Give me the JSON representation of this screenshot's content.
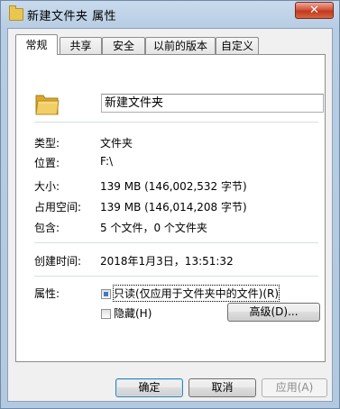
{
  "window": {
    "title": "新建文件夹 属性",
    "close_label": "✕"
  },
  "tabs": [
    {
      "label": "常规",
      "active": true
    },
    {
      "label": "共享",
      "active": false
    },
    {
      "label": "安全",
      "active": false
    },
    {
      "label": "以前的版本",
      "active": false
    },
    {
      "label": "自定义",
      "active": false
    }
  ],
  "general": {
    "name_value": "新建文件夹",
    "type_label": "类型:",
    "type_value": "文件夹",
    "location_label": "位置:",
    "location_value": "F:\\",
    "size_label": "大小:",
    "size_value": "139 MB (146,002,532 字节)",
    "size_on_disk_label": "占用空间:",
    "size_on_disk_value": "139 MB (146,014,208 字节)",
    "contains_label": "包含:",
    "contains_value": "5 个文件，0 个文件夹",
    "created_label": "创建时间:",
    "created_value": "2018年1月3日，13:51:32",
    "attributes_label": "属性:",
    "readonly_label": "只读(仅应用于文件夹中的文件)(R)",
    "readonly_state": "indeterminate",
    "hidden_label": "隐藏(H)",
    "hidden_state": "unchecked",
    "advanced_label": "高级(D)..."
  },
  "buttons": {
    "ok": "确定",
    "cancel": "取消",
    "apply": "应用(A)"
  },
  "colors": {
    "frame": "#b3c9e0",
    "close": "#c7432a",
    "checkbox_fill": "#3d78c9"
  }
}
